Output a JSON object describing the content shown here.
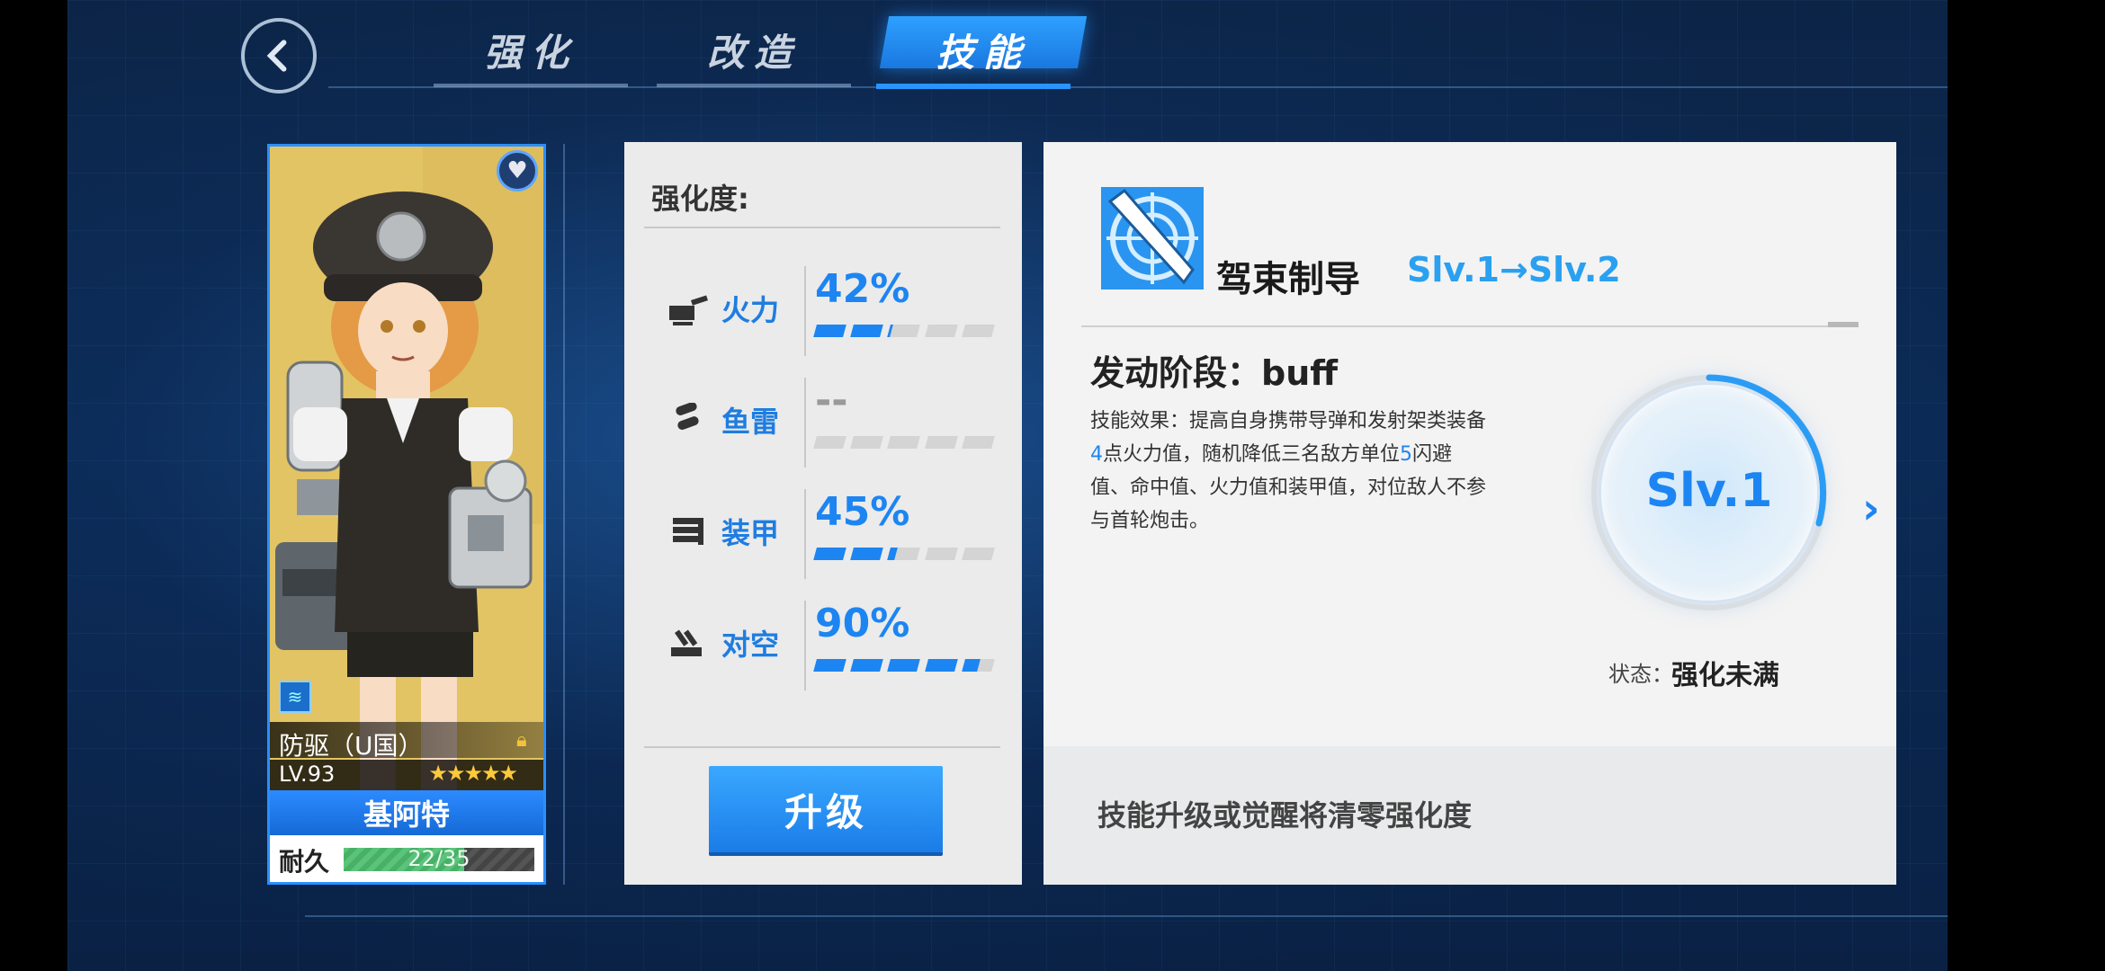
{
  "tabs": [
    {
      "label": "强化",
      "active": false
    },
    {
      "label": "改造",
      "active": false
    },
    {
      "label": "技能",
      "active": true
    }
  ],
  "character": {
    "class_text": "防驱（U国）",
    "level": "LV.93",
    "stars": "★★★★★",
    "name": "基阿特",
    "durability_label": "耐久",
    "durability_text": "22/35",
    "durability_fraction": 0.63
  },
  "enhancement": {
    "title": "强化度:",
    "stats": [
      {
        "label": "火力",
        "value": "42%",
        "fill": 0.42
      },
      {
        "label": "鱼雷",
        "value": "--",
        "fill": 0
      },
      {
        "label": "装甲",
        "value": "45%",
        "fill": 0.45
      },
      {
        "label": "对空",
        "value": "90%",
        "fill": 0.9
      }
    ],
    "upgrade_label": "升级"
  },
  "skill": {
    "name": "驾束制导",
    "level_change": "Slv.1→Slv.2",
    "phase": "发动阶段：buff",
    "desc_1": "技能效果：提高自身携带导弹和发射架类装备",
    "desc_num1": "4",
    "desc_2": "点火力值，随机降低三名敌方单位",
    "desc_num2": "5",
    "desc_3": "闪避值、命中值、火力值和装甲值，对位敌人不参与首轮炮击。",
    "current_level": "Slv.1",
    "status_label": "状态：",
    "status_value": "强化未满",
    "notice": "技能升级或觉醒将清零强化度"
  },
  "colors": {
    "accent": "#1d85f2",
    "panel": "#ebebeb",
    "background": "#0b2a55"
  }
}
